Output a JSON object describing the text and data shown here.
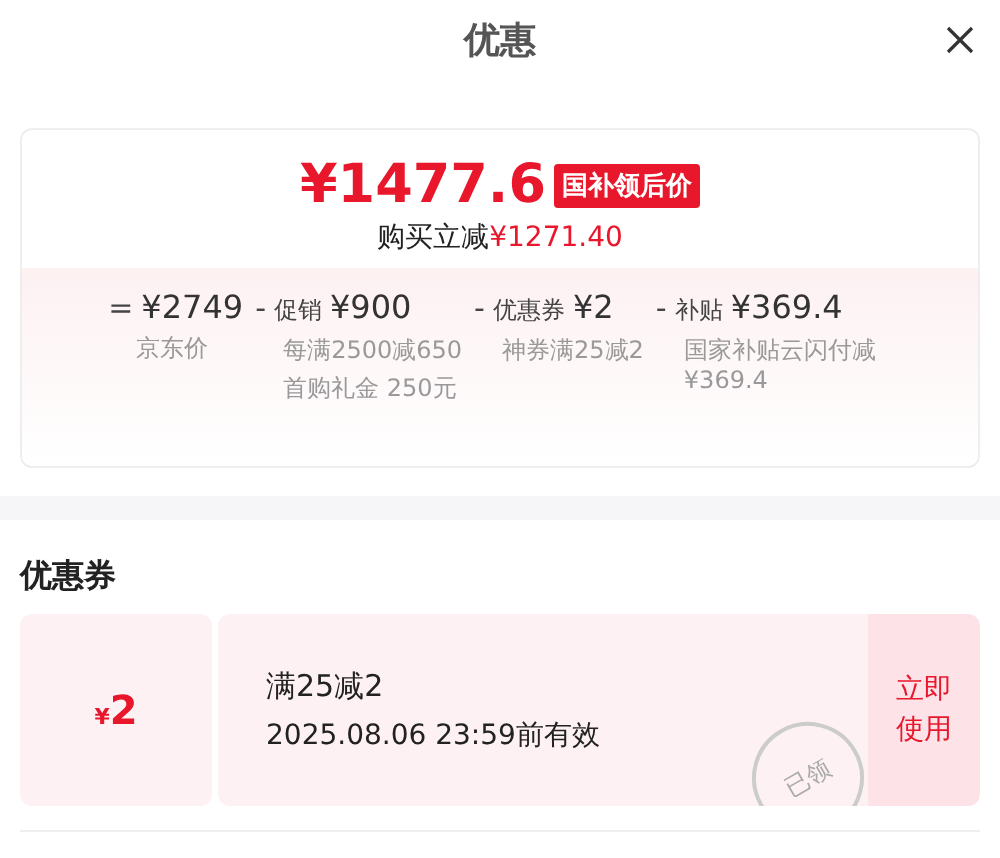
{
  "header": {
    "title": "优惠"
  },
  "summary": {
    "price": "¥1477.6",
    "price_tag": "国补领后价",
    "saving_label": "购买立减",
    "saving_amount": "¥1271.40",
    "breakdown": [
      {
        "op": "=",
        "amount": "¥2749",
        "notes": [
          "京东价"
        ]
      },
      {
        "op": "-",
        "label": "促销",
        "amount": "¥900",
        "notes": [
          "每满2500减650",
          "首购礼金 250元"
        ]
      },
      {
        "op": "-",
        "label": "优惠券",
        "amount": "¥2",
        "notes": [
          "神券满25减2"
        ]
      },
      {
        "op": "-",
        "label": "补贴",
        "amount": "¥369.4",
        "notes": [
          "国家补贴云闪付减¥369.4"
        ]
      }
    ]
  },
  "coupons_section": {
    "title": "优惠券",
    "coupons": [
      {
        "currency": "¥",
        "amount": "2",
        "condition": "满25减2",
        "validity": "2025.08.06 23:59前有效",
        "claimed": true,
        "stamp": "已领",
        "action": "立即使用"
      }
    ]
  }
}
